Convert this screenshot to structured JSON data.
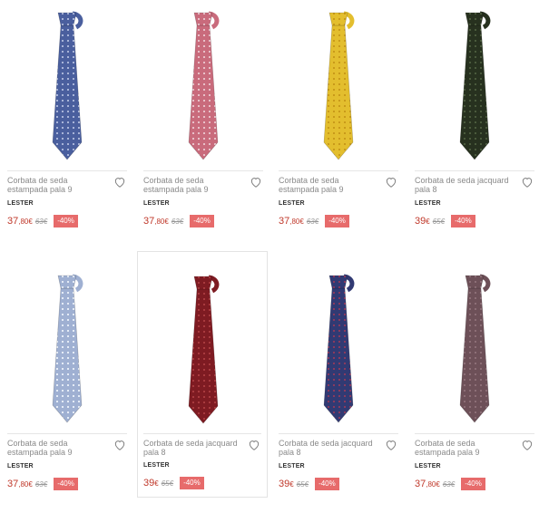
{
  "products": [
    {
      "name": "Corbata de seda estampada pala 9",
      "brand": "LESTER",
      "price_main": "37",
      "price_dec": ",80€",
      "old_price": "63€",
      "discount": "-40%",
      "tie_color": "#4a5f9e",
      "pattern_color": "#a8b4d8"
    },
    {
      "name": "Corbata de seda estampada pala 9",
      "brand": "LESTER",
      "price_main": "37",
      "price_dec": ",80€",
      "old_price": "63€",
      "discount": "-40%",
      "tie_color": "#c96b7c",
      "pattern_color": "#e8c0c8"
    },
    {
      "name": "Corbata de seda estampada pala 9",
      "brand": "LESTER",
      "price_main": "37",
      "price_dec": ",80€",
      "old_price": "63€",
      "discount": "-40%",
      "tie_color": "#e3be2e",
      "pattern_color": "#c99a1a"
    },
    {
      "name": "Corbata de seda jacquard pala 8",
      "brand": "LESTER",
      "price_main": "39",
      "price_dec": "€",
      "old_price": "65€",
      "discount": "-40%",
      "tie_color": "#27311f",
      "pattern_color": "#4a5a3c"
    },
    {
      "name": "Corbata de seda estampada pala 9",
      "brand": "LESTER",
      "price_main": "37",
      "price_dec": ",80€",
      "old_price": "63€",
      "discount": "-40%",
      "tie_color": "#9fb0d2",
      "pattern_color": "#e4ebf6"
    },
    {
      "name": "Corbata de seda jacquard pala 8",
      "brand": "LESTER",
      "price_main": "39",
      "price_dec": "€",
      "old_price": "65€",
      "discount": "-40%",
      "tie_color": "#7e1b22",
      "pattern_color": "#a83a3e"
    },
    {
      "name": "Corbata de seda jacquard pala 8",
      "brand": "LESTER",
      "price_main": "39",
      "price_dec": "€",
      "old_price": "65€",
      "discount": "-40%",
      "tie_color": "#313a73",
      "pattern_color": "#8a3a5e"
    },
    {
      "name": "Corbata de seda estampada pala 9",
      "brand": "LESTER",
      "price_main": "37",
      "price_dec": ",80€",
      "old_price": "63€",
      "discount": "-40%",
      "tie_color": "#6d5058",
      "pattern_color": "#8c6e76"
    }
  ],
  "colors": {
    "price": "#c0392b",
    "badge": "#e76b6b"
  }
}
